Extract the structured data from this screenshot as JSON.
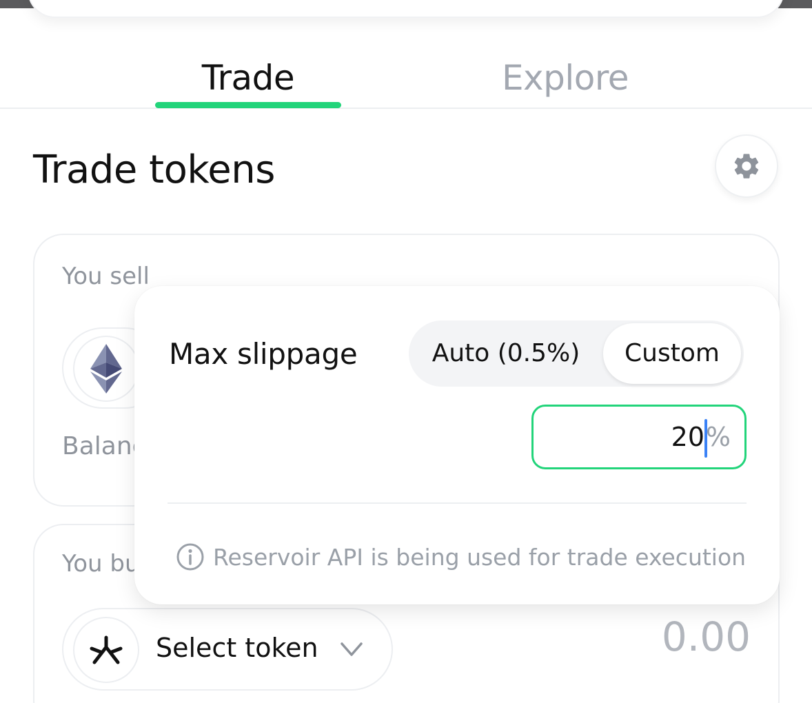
{
  "tabs": [
    {
      "label": "Trade",
      "active": true
    },
    {
      "label": "Explore",
      "active": false
    }
  ],
  "colors": {
    "accent": "#22d47a",
    "caret": "#3b82f6",
    "muted": "#9aa0a8"
  },
  "page_title": "Trade tokens",
  "settings": {
    "icon": "gear-icon"
  },
  "sell": {
    "label": "You sell",
    "token_icon": "ethereum-icon",
    "balance_label": "Balanc"
  },
  "buy": {
    "label": "You bu",
    "select_label": "Select token",
    "token_icon": "reservoir-icon",
    "amount": "0.00"
  },
  "slippage": {
    "title": "Max slippage",
    "options": [
      "Auto (0.5%)",
      "Custom"
    ],
    "selected": "Custom",
    "value": "20",
    "unit": "%",
    "info": "Reservoir API is being used for trade execution"
  }
}
